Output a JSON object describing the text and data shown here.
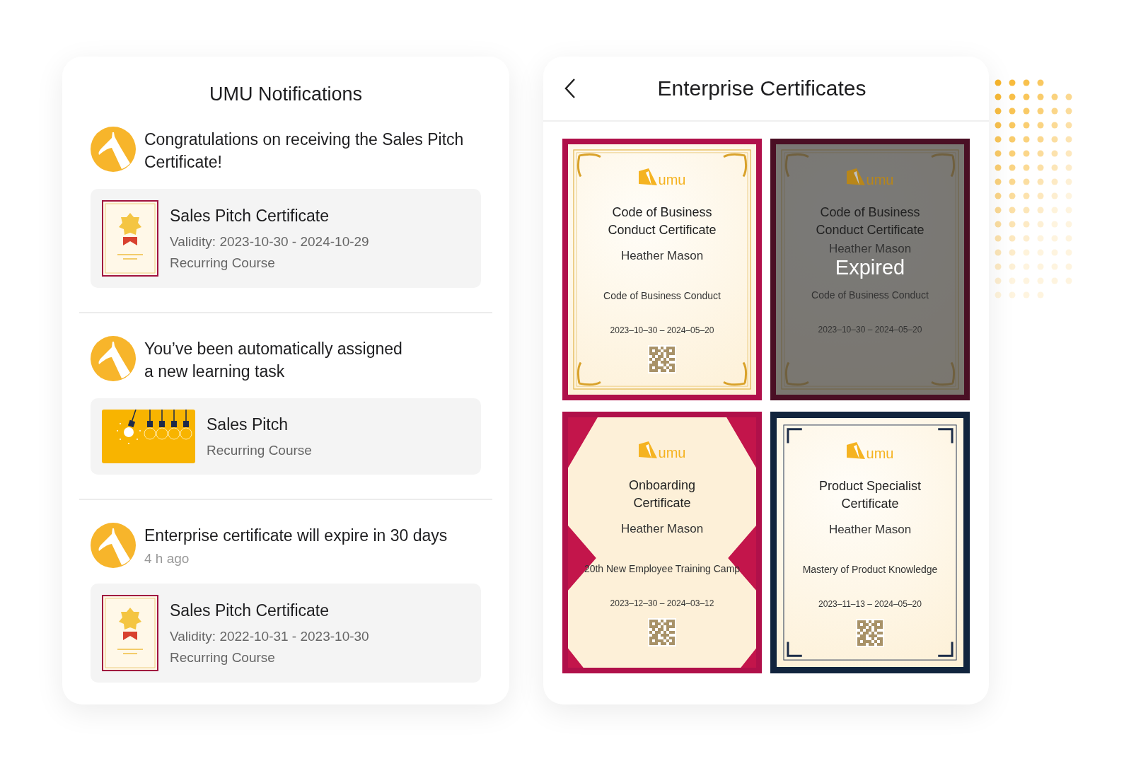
{
  "notifications_panel": {
    "title": "UMU Notifications",
    "notifications": [
      {
        "message": "Congratulations on receiving the Sales Pitch Certificate!",
        "item": {
          "kind": "certificate",
          "title": "Sales Pitch Certificate",
          "validity": "Validity: 2023-10-30 - 2024-10-29",
          "type": "Recurring Course"
        }
      },
      {
        "message": "You’ve been automatically assigned\na new learning task",
        "item": {
          "kind": "course",
          "title": "Sales Pitch",
          "type": "Recurring Course"
        }
      },
      {
        "message": "Enterprise certificate will expire in 30 days",
        "time": "4 h ago",
        "item": {
          "kind": "certificate",
          "title": "Sales Pitch Certificate",
          "validity": "Validity: 2022-10-31 - 2023-10-30",
          "type": "Recurring Course"
        }
      }
    ]
  },
  "certificates_panel": {
    "title": "Enterprise Certificates",
    "certificates": [
      {
        "kind": "classic",
        "expired": false,
        "logo": "umu",
        "title": "Code of Business Conduct Certificate",
        "holder": "Heather Mason",
        "course": "Code of Business Conduct",
        "dates": "2023–10–30 – 2024–05–20"
      },
      {
        "kind": "classic",
        "expired": true,
        "logo": "umu",
        "title": "Code of Business Conduct Certificate",
        "holder": "Heather Mason",
        "status_label": "Expired",
        "course": "Code of Business Conduct",
        "dates": "2023–10–30 – 2024–05–20"
      },
      {
        "kind": "ribbon",
        "expired": false,
        "logo": "umu",
        "title": "Onboarding Certificate",
        "holder": "Heather Mason",
        "course": "20th New Employee Training Camp",
        "dates": "2023–12–30 – 2024–03–12"
      },
      {
        "kind": "framed",
        "expired": false,
        "logo": "umu",
        "title": "Product Specialist Certificate",
        "holder": "Heather Mason",
        "course": "Mastery of Product Knowledge",
        "dates": "2023–11–13 – 2024–05–20"
      }
    ]
  }
}
